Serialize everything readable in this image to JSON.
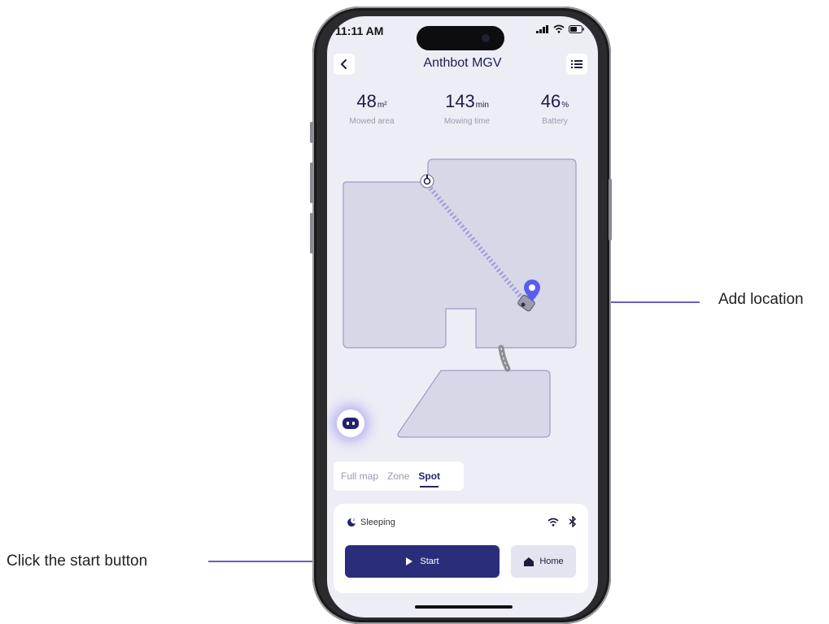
{
  "status_bar": {
    "time": "11:11 AM"
  },
  "header": {
    "title": "Anthbot MGV"
  },
  "stats": [
    {
      "value": "48",
      "unit": "m²",
      "label": "Mowed area"
    },
    {
      "value": "143",
      "unit": "min",
      "label": "Mowing time"
    },
    {
      "value": "46",
      "unit": "%",
      "label": "Battery"
    }
  ],
  "mode_tabs": [
    {
      "label": "Full map",
      "active": false
    },
    {
      "label": "Zone",
      "active": false
    },
    {
      "label": "Spot",
      "active": true
    }
  ],
  "status_panel": {
    "state": "Sleeping",
    "start_label": "Start",
    "home_label": "Home"
  },
  "annotations": {
    "add_location": "Add location",
    "click_start": "Click the start button"
  },
  "colors": {
    "accent": "#2a2d7a",
    "pin": "#5b5cf0",
    "lawn": "#d8d7e8",
    "callout": "#6f5bc7"
  }
}
